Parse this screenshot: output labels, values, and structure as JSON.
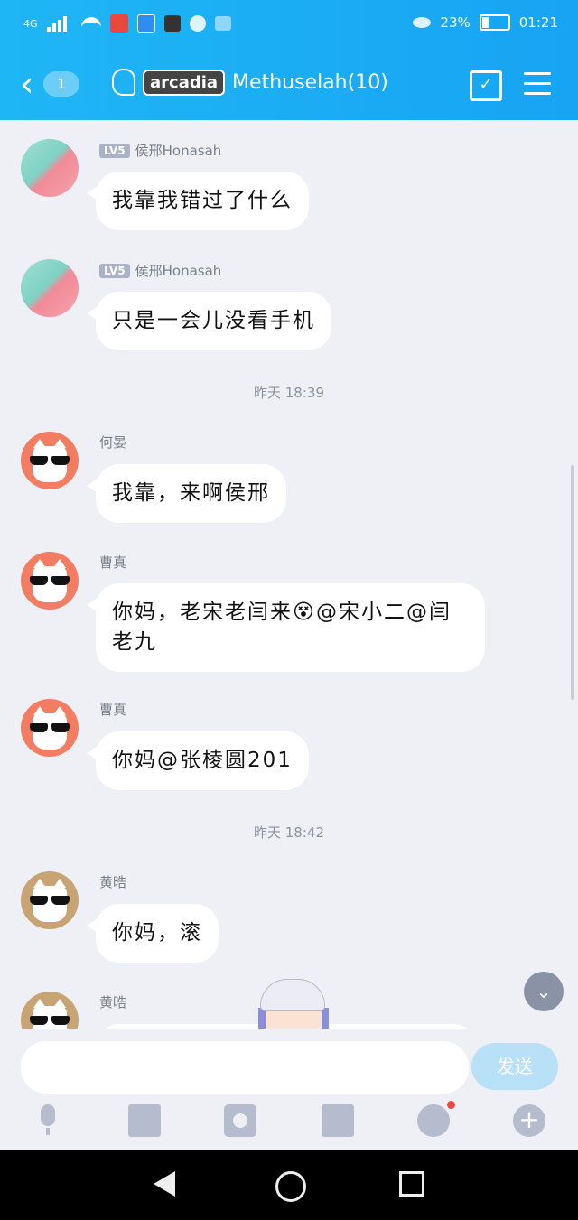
{
  "status_bar": {
    "network": "4G",
    "battery_percent_text": "23%",
    "battery_level": 0.23,
    "time": "01:21"
  },
  "header": {
    "unread_count": "1",
    "title_tag": "arcadia",
    "title": "Methuselah(10)"
  },
  "messages": [
    {
      "sender": "侯邢Honasah",
      "level": "LV5",
      "text": "我靠我错过了什么"
    },
    {
      "sender": "侯邢Honasah",
      "level": "LV5",
      "text": "只是一会儿没看手机"
    },
    {
      "timestamp": "昨天 18:39"
    },
    {
      "sender": "何晏",
      "text": "我靠，来啊侯邢"
    },
    {
      "sender": "曹真",
      "text": "你妈，老宋老闫来😵@宋小二@闫老九"
    },
    {
      "sender": "曹真",
      "text": "你妈@张棱圆201"
    },
    {
      "timestamp": "昨天 18:42"
    },
    {
      "sender": "黄晧",
      "text": "你妈，滚"
    },
    {
      "sender": "黄晧",
      "text": ""
    }
  ],
  "input": {
    "placeholder": "",
    "send_label": "发送"
  },
  "colors": {
    "header_bg": "#1fb6f5",
    "chat_bg": "#eef0f6",
    "send_button": "#b8e0f7"
  }
}
